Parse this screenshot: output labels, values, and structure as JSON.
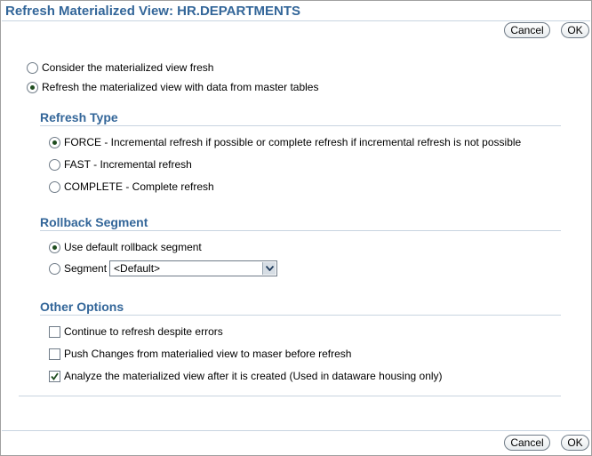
{
  "title": "Refresh Materialized View: HR.DEPARTMENTS",
  "buttons": {
    "cancel": "Cancel",
    "ok": "OK"
  },
  "mode_options": [
    {
      "label": "Consider the materialized view fresh",
      "selected": false
    },
    {
      "label": "Refresh the materialized view with data from master tables",
      "selected": true
    }
  ],
  "refresh_type": {
    "heading": "Refresh Type",
    "options": [
      {
        "label": "FORCE - Incremental refresh if possible or complete refresh if incremental refresh is not possible",
        "selected": true
      },
      {
        "label": "FAST - Incremental refresh",
        "selected": false
      },
      {
        "label": "COMPLETE - Complete refresh",
        "selected": false
      }
    ]
  },
  "rollback_segment": {
    "heading": "Rollback Segment",
    "default_label": "Use default rollback segment",
    "default_selected": true,
    "segment_label": "Segment",
    "segment_selected": false,
    "segment_value": "<Default>"
  },
  "other_options": {
    "heading": "Other Options",
    "items": [
      {
        "label": "Continue to refresh despite errors",
        "checked": false
      },
      {
        "label": "Push Changes from materialied view to maser before refresh",
        "checked": false
      },
      {
        "label": "Analyze the materialized view after it is created (Used in dataware housing only)",
        "checked": true
      }
    ]
  },
  "icons": {
    "dropdown": "chevron-down-icon",
    "check": "check-mark-icon"
  },
  "colors": {
    "accent": "#336699",
    "rule": "#c8d4e0"
  }
}
